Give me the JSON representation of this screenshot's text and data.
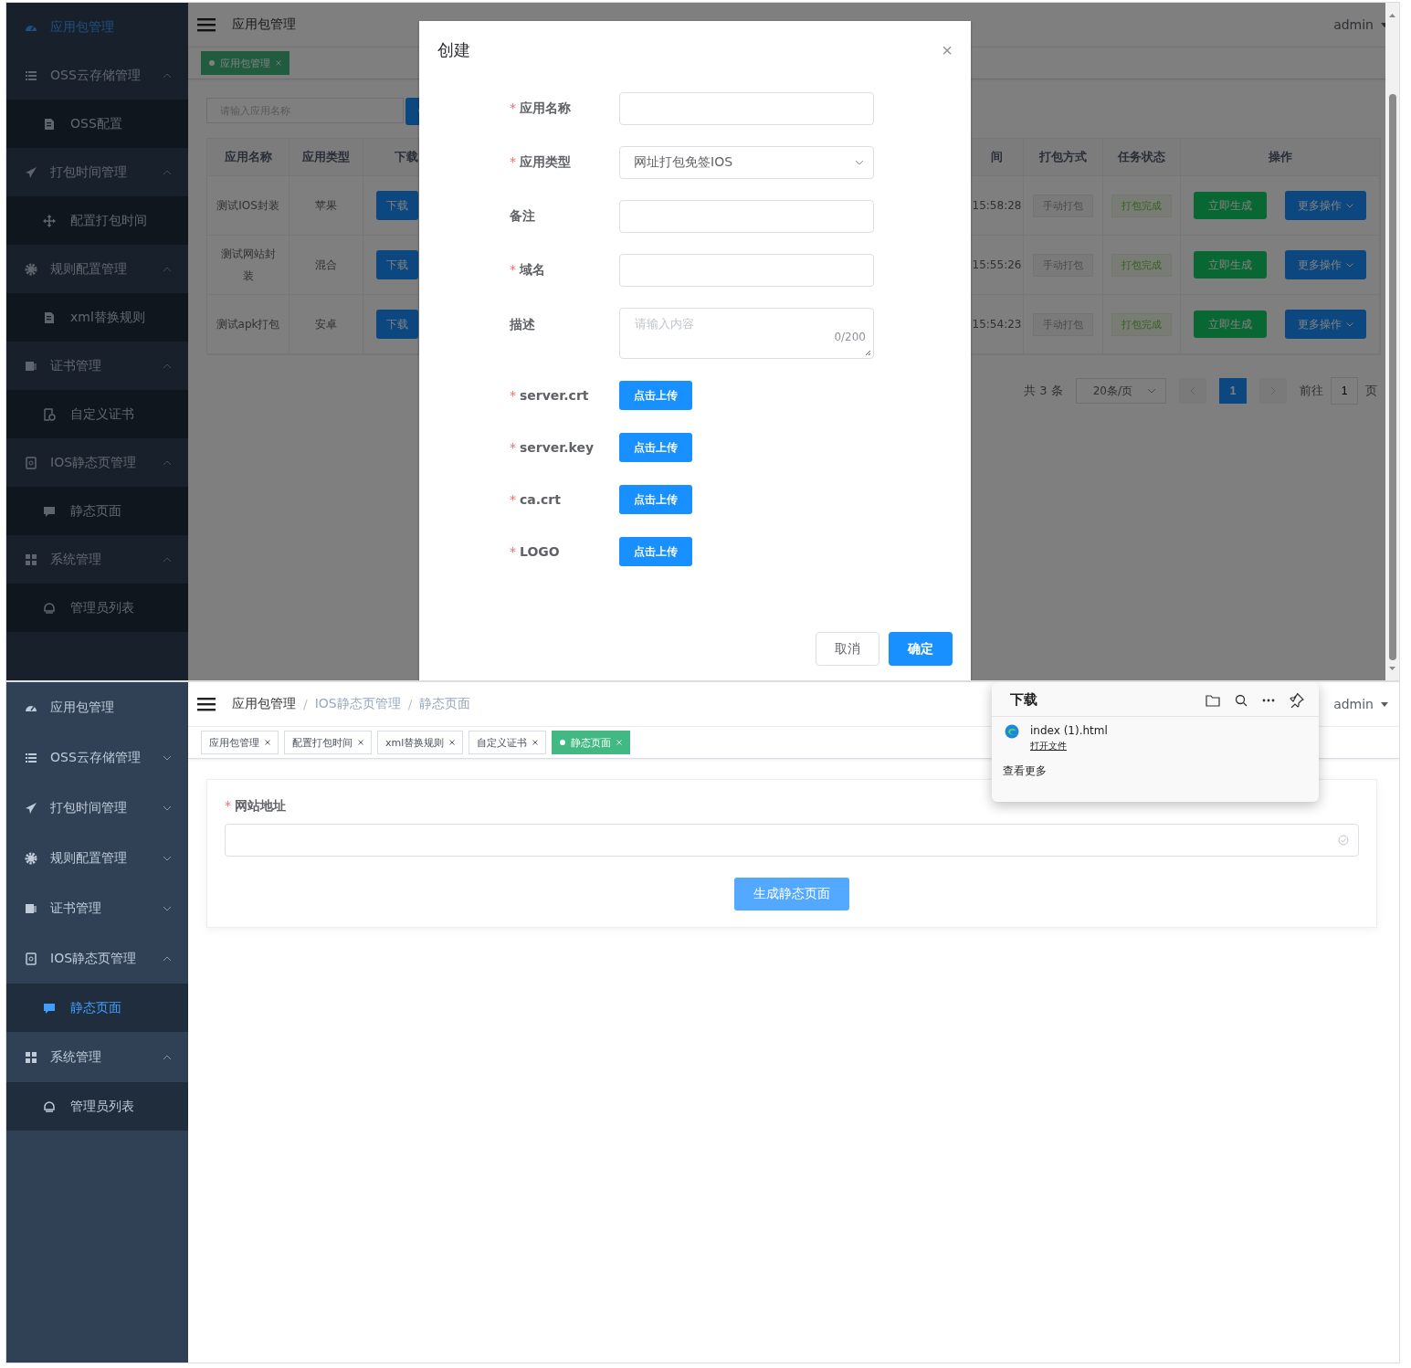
{
  "top_screen": {
    "sidebar": {
      "menu": [
        {
          "label": "应用包管理",
          "selected": true
        },
        {
          "label": "OSS云存储管理",
          "selected": false,
          "expanded": true,
          "children": [
            {
              "label": "OSS配置",
              "selected": false
            }
          ]
        },
        {
          "label": "打包时间管理",
          "selected": false,
          "expanded": true,
          "children": [
            {
              "label": "配置打包时间",
              "selected": false
            }
          ]
        },
        {
          "label": "规则配置管理",
          "selected": false,
          "expanded": true,
          "children": [
            {
              "label": "xml替换规则",
              "selected": false
            }
          ]
        },
        {
          "label": "证书管理",
          "selected": false,
          "expanded": true,
          "children": [
            {
              "label": "自定义证书",
              "selected": false
            }
          ]
        },
        {
          "label": "IOS静态页管理",
          "selected": false,
          "expanded": true,
          "children": [
            {
              "label": "静态页面",
              "selected": false
            }
          ]
        },
        {
          "label": "系统管理",
          "selected": false,
          "expanded": true,
          "children": [
            {
              "label": "管理员列表",
              "selected": false
            }
          ]
        }
      ]
    },
    "header": {
      "breadcrumbs": [
        "应用包管理"
      ],
      "user": "admin"
    },
    "tags": [
      {
        "label": "应用包管理",
        "selected": true
      }
    ],
    "search": {
      "placeholder": "请输入应用名称"
    },
    "table": {
      "columns_left": [
        "应用名称",
        "应用类型",
        "下载"
      ],
      "columns_right": [
        "间",
        "打包方式",
        "任务状态",
        "操作"
      ],
      "rows": [
        {
          "name": "测试IOS封装",
          "type": "苹果",
          "download": "下载",
          "time": "15:58:28",
          "pack": "手动打包",
          "status": "打包完成",
          "actions": [
            "立即生成",
            "更多操作"
          ]
        },
        {
          "name": "测试网站封装",
          "type": "混合",
          "download": "下载",
          "time": "15:55:26",
          "pack": "手动打包",
          "status": "打包完成",
          "actions": [
            "立即生成",
            "更多操作"
          ]
        },
        {
          "name": "测试apk打包",
          "type": "安卓",
          "download": "下载",
          "time": "15:54:23",
          "pack": "手动打包",
          "status": "打包完成",
          "actions": [
            "立即生成",
            "更多操作"
          ]
        }
      ]
    },
    "pagination": {
      "total": "共 3 条",
      "page_size": "20条/页",
      "pages": [
        {
          "label": "1",
          "selected": true
        }
      ],
      "goto_label": "前往",
      "goto_value": "1",
      "goto_suffix": "页"
    },
    "dialog": {
      "title": "创建",
      "close": "×",
      "required_mark": "*",
      "fields": [
        {
          "kind": "input",
          "label": "应用名称",
          "required": true
        },
        {
          "kind": "select",
          "label": "应用类型",
          "required": true,
          "value": "网址打包免签IOS"
        },
        {
          "kind": "input",
          "label": "备注",
          "required": false
        },
        {
          "kind": "input",
          "label": "域名",
          "required": true
        },
        {
          "kind": "textarea",
          "label": "描述",
          "required": false,
          "placeholder": "请输入内容",
          "counter": "0/200"
        },
        {
          "kind": "upload",
          "label": "server.crt",
          "required": true,
          "button": "点击上传"
        },
        {
          "kind": "upload",
          "label": "server.key",
          "required": true,
          "button": "点击上传"
        },
        {
          "kind": "upload",
          "label": "ca.crt",
          "required": true,
          "button": "点击上传"
        },
        {
          "kind": "upload",
          "label": "LOGO",
          "required": true,
          "button": "点击上传"
        }
      ],
      "buttons": [
        {
          "label": "取消",
          "kind": "default"
        },
        {
          "label": "确定",
          "kind": "primary"
        }
      ]
    }
  },
  "bottom_screen": {
    "sidebar": {
      "menu": [
        {
          "label": "应用包管理",
          "selected": false
        },
        {
          "label": "OSS云存储管理",
          "selected": false,
          "expanded": false
        },
        {
          "label": "打包时间管理",
          "selected": false,
          "expanded": false
        },
        {
          "label": "规则配置管理",
          "selected": false,
          "expanded": false
        },
        {
          "label": "证书管理",
          "selected": false,
          "expanded": false
        },
        {
          "label": "IOS静态页管理",
          "selected": false,
          "expanded": true,
          "children": [
            {
              "label": "静态页面",
              "selected": true
            }
          ]
        },
        {
          "label": "系统管理",
          "selected": false,
          "expanded": true,
          "children": [
            {
              "label": "管理员列表",
              "selected": false
            }
          ]
        }
      ]
    },
    "header": {
      "breadcrumbs": [
        "应用包管理",
        "IOS静态页管理",
        "静态页面"
      ],
      "separators": [
        "/",
        "/"
      ],
      "user": "admin"
    },
    "tags": [
      {
        "label": "应用包管理",
        "selected": false
      },
      {
        "label": "配置打包时间",
        "selected": false
      },
      {
        "label": "xml替换规则",
        "selected": false
      },
      {
        "label": "自定义证书",
        "selected": false
      },
      {
        "label": "静态页面",
        "selected": true
      }
    ],
    "form": {
      "label": "网站地址",
      "required": true,
      "required_mark": "*",
      "button": "生成静态页面"
    },
    "downloads_panel": {
      "title": "下载",
      "files": [
        {
          "name": "index (1).html",
          "action": "打开文件"
        }
      ],
      "more": "查看更多"
    }
  }
}
